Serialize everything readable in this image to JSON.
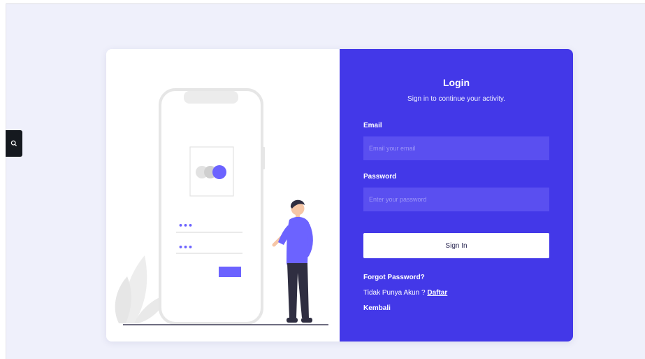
{
  "login": {
    "title": "Login",
    "subtitle": "Sign in to continue your activity.",
    "email_label": "Email",
    "email_placeholder": "Email your email",
    "email_value": "",
    "password_label": "Password",
    "password_placeholder": "Enter your password",
    "password_value": "",
    "signin_label": "Sign In",
    "forgot_label": "Forgot Password?",
    "no_account_text": "Tidak Punya Akun ?",
    "register_label": "Daftar",
    "back_label": "Kembali"
  },
  "illustration": {
    "phone_dots_1": "•••",
    "phone_dots_2": "•••"
  },
  "colors": {
    "accent": "#4338e8",
    "input_bg": "#5a4ff0",
    "page_bg": "#eff0fb",
    "illustration_accent": "#6c63ff"
  }
}
